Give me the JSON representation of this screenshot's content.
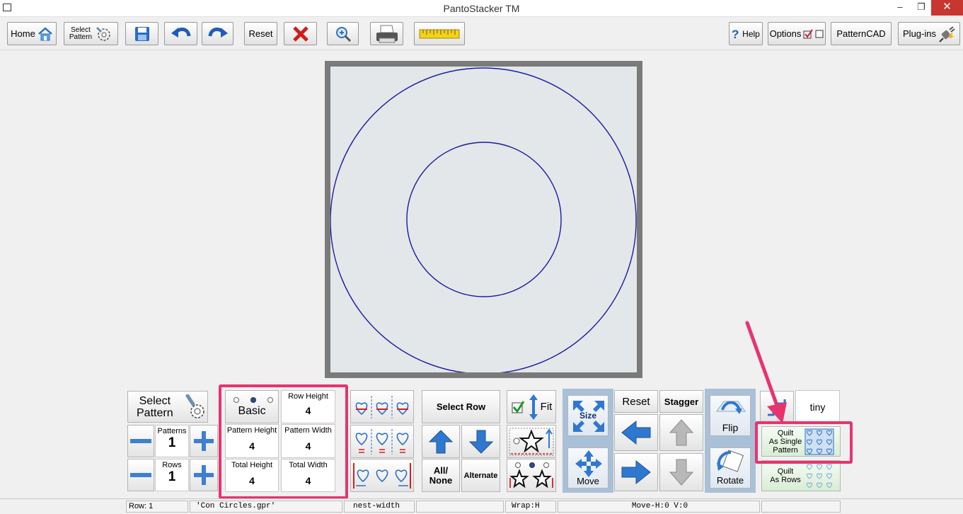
{
  "window": {
    "title": "PantoStacker TM",
    "minimize": "–",
    "restore": "❐",
    "close": "✕"
  },
  "toolbar": {
    "home": "Home",
    "select_pattern_line1": "Select",
    "select_pattern_line2": "Pattern",
    "reset": "Reset",
    "help": "Help",
    "options": "Options",
    "patterncad": "PatternCAD",
    "plugins": "Plug-ins"
  },
  "panel": {
    "select_pattern_line1": "Select",
    "select_pattern_line2": "Pattern",
    "patterns_label": "Patterns",
    "patterns_value": "1",
    "rows_label": "Rows",
    "rows_value": "1",
    "basic": "Basic",
    "row_height_label": "Row Height",
    "row_height_value": "4",
    "pattern_height_label": "Pattern Height",
    "pattern_height_value": "4",
    "pattern_width_label": "Pattern Width",
    "pattern_width_value": "4",
    "total_height_label": "Total Height",
    "total_height_value": "4",
    "total_width_label": "Total Width",
    "total_width_value": "4",
    "select_row": "Select Row",
    "all_none_line1": "All/",
    "all_none_line2": "None",
    "alternate": "Alternate",
    "fit": "Fit",
    "size": "Size",
    "move": "Move",
    "reset": "Reset",
    "stagger": "Stagger",
    "flip": "Flip",
    "rotate": "Rotate",
    "tiny": "tiny",
    "quilt_single_line1": "Quilt",
    "quilt_single_line2": "As Single",
    "quilt_single_line3": "Pattern",
    "quilt_rows_line1": "Quilt",
    "quilt_rows_line2": "As Rows"
  },
  "status": {
    "row": "Row: 1",
    "file": "'Con Circles.gpr'",
    "mode": "nest-width",
    "wrap": "Wrap:H",
    "move": "Move-H:0 V:0"
  },
  "colors": {
    "highlight": "#e8336d",
    "circle_stroke": "#1a1aa0",
    "canvas_bg": "#e4e7e9",
    "frame": "#7a7a7a"
  }
}
